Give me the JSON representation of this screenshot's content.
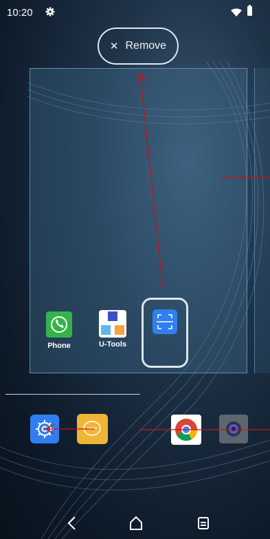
{
  "status_bar": {
    "time": "10:20"
  },
  "remove_action": {
    "label": "Remove",
    "icon": "close-icon"
  },
  "apps": [
    {
      "label": "Phone",
      "icon": "phone-icon",
      "color": "#34b34a"
    },
    {
      "label": "U-Tools",
      "icon": "utools-icon",
      "color": "#ffffff"
    }
  ],
  "dragged_app": {
    "icon": "scanner-icon",
    "color": "#2f7ff0"
  },
  "dock": [
    {
      "icon": "settings-icon",
      "color": "#2f7ff0"
    },
    {
      "icon": "messages-icon",
      "color": "#f1b535"
    },
    {
      "icon": "chrome-icon",
      "color": "#ffffff"
    },
    {
      "icon": "camera-icon",
      "color": "#5c6670"
    }
  ],
  "nav": [
    "back-icon",
    "home-icon",
    "recents-icon"
  ],
  "colors": {
    "annotation_arrow": "#cc1111",
    "frame": "#5b8fb8"
  }
}
